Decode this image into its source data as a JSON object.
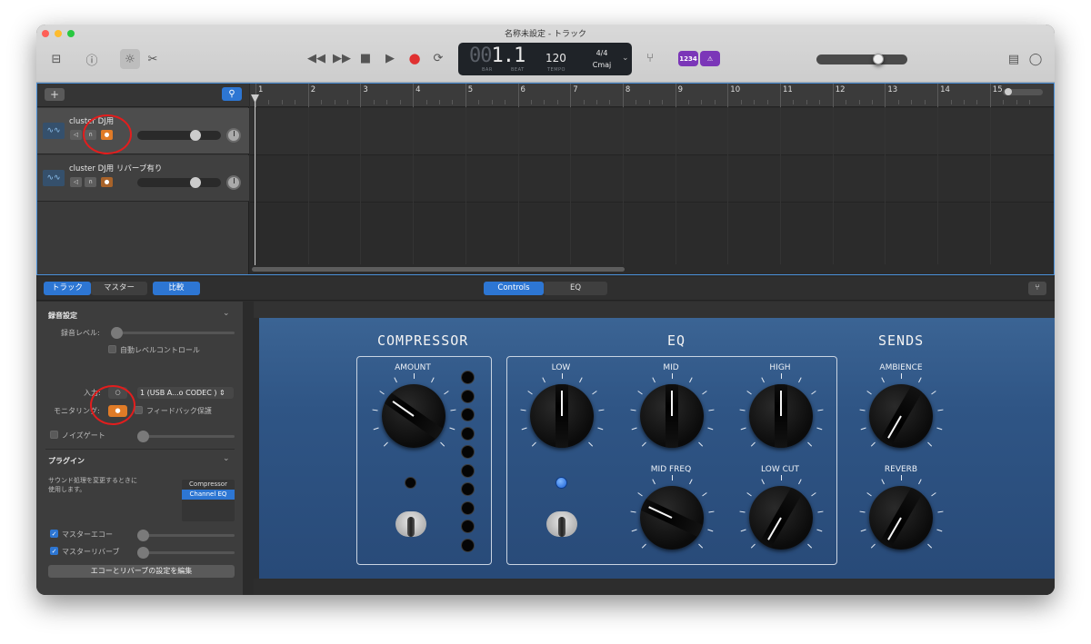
{
  "window": {
    "title": "名称未設定 - トラック",
    "colors": {
      "accent": "#2d76d3",
      "record": "#e03131",
      "monitor": "#e07b27",
      "purple": "#7b36b8",
      "panel": "#2f5585"
    }
  },
  "toolbar": {
    "lcd": {
      "bar": "00",
      "beat": "1.1",
      "bar_label": "BAR",
      "beat_label": "BEAT",
      "tempo": "120",
      "tempo_label": "TEMPO",
      "time_signature": "4/4",
      "key": "Cmaj"
    },
    "count_in_label": "1234",
    "icons": [
      "library-icon",
      "help-icon",
      "smart-controls-icon",
      "scissors-icon",
      "rewind-icon",
      "forward-icon",
      "stop-icon",
      "play-icon",
      "record-icon",
      "cycle-icon",
      "tuner-icon",
      "count-in-icon",
      "metronome-icon",
      "notepad-icon",
      "loop-browser-icon"
    ]
  },
  "tracks": [
    {
      "name": "cluster DJ用",
      "selected": true,
      "record_enabled": true
    },
    {
      "name": "cluster DJ用 リバーブ有り",
      "selected": false,
      "record_enabled": true
    }
  ],
  "ruler": {
    "bars": [
      "1",
      "2",
      "3",
      "4",
      "5",
      "6",
      "7",
      "8",
      "9",
      "10",
      "11",
      "12",
      "13",
      "14",
      "15"
    ]
  },
  "bottom_bar": {
    "tabs": [
      "トラック",
      "マスター"
    ],
    "compare": "比較",
    "views": [
      "Controls",
      "EQ"
    ],
    "active_view": "Controls"
  },
  "inspector": {
    "recording_settings": "録音設定",
    "record_level": "録音レベル:",
    "auto_level": "自動レベルコントロール",
    "input_label": "入力:",
    "input_value": "1 (USB A...o CODEC )",
    "monitoring_label": "モニタリング:",
    "feedback_protection": "フィードバック保護",
    "noise_gate": "ノイズゲート",
    "plugins": "プラグイン",
    "plugins_desc": "サウンド処理を変更するときに使用します。",
    "plugin_list": [
      "Compressor",
      "Channel EQ"
    ],
    "selected_plugin": "Channel EQ",
    "master_echo": "マスターエコー",
    "master_reverb": "マスターリバーブ",
    "edit_button": "エコーとリバーブの設定を編集"
  },
  "smart_controls": {
    "compressor": {
      "title": "COMPRESSOR",
      "amount_label": "AMOUNT"
    },
    "eq": {
      "title": "EQ",
      "low": "LOW",
      "mid": "MID",
      "high": "HIGH",
      "mid_freq": "MID FREQ",
      "low_cut": "LOW CUT"
    },
    "sends": {
      "title": "SENDS",
      "ambience": "AMBIENCE",
      "reverb": "REVERB"
    }
  }
}
